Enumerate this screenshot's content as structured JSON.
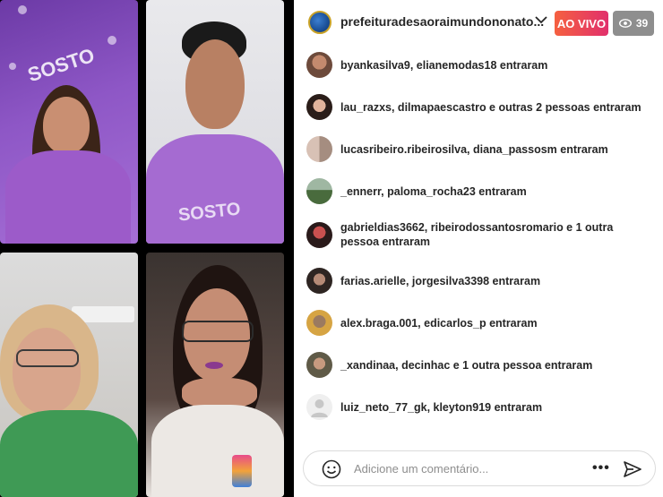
{
  "header": {
    "account_name": "prefeituradesaoraimundononato...",
    "live_label": "AO VIVO",
    "viewer_count": "39"
  },
  "video_tiles": {
    "banner_text": "SOSTO"
  },
  "feed": {
    "items": [
      {
        "text": "byankasilva9, elianemodas18 entraram"
      },
      {
        "text": "lau_razxs, dilmapaescastro e outras 2 pessoas entraram"
      },
      {
        "text": "lucasribeiro.ribeirosilva, diana_passosm entraram"
      },
      {
        "text": "_ennerr, paloma_rocha23 entraram"
      },
      {
        "text": "gabrieldias3662, ribeirodossantosromario e 1 outra pessoa entraram"
      },
      {
        "text": "farias.arielle, jorgesilva3398 entraram"
      },
      {
        "text": "alex.braga.001, edicarlos_p entraram"
      },
      {
        "text": "_xandinaa, decinhac e 1 outra pessoa entraram"
      },
      {
        "text": "luiz_neto_77_gk, kleyton919 entraram"
      }
    ]
  },
  "comment": {
    "placeholder": "Adicione um comentário..."
  },
  "colors": {
    "live_gradient_start": "#f56040",
    "live_gradient_end": "#e1306c",
    "viewer_badge": "#8e8e8e",
    "text": "#262626"
  },
  "icons": [
    "eye-icon",
    "chevron-down-icon",
    "emoji-icon",
    "more-options-icon",
    "send-icon"
  ]
}
